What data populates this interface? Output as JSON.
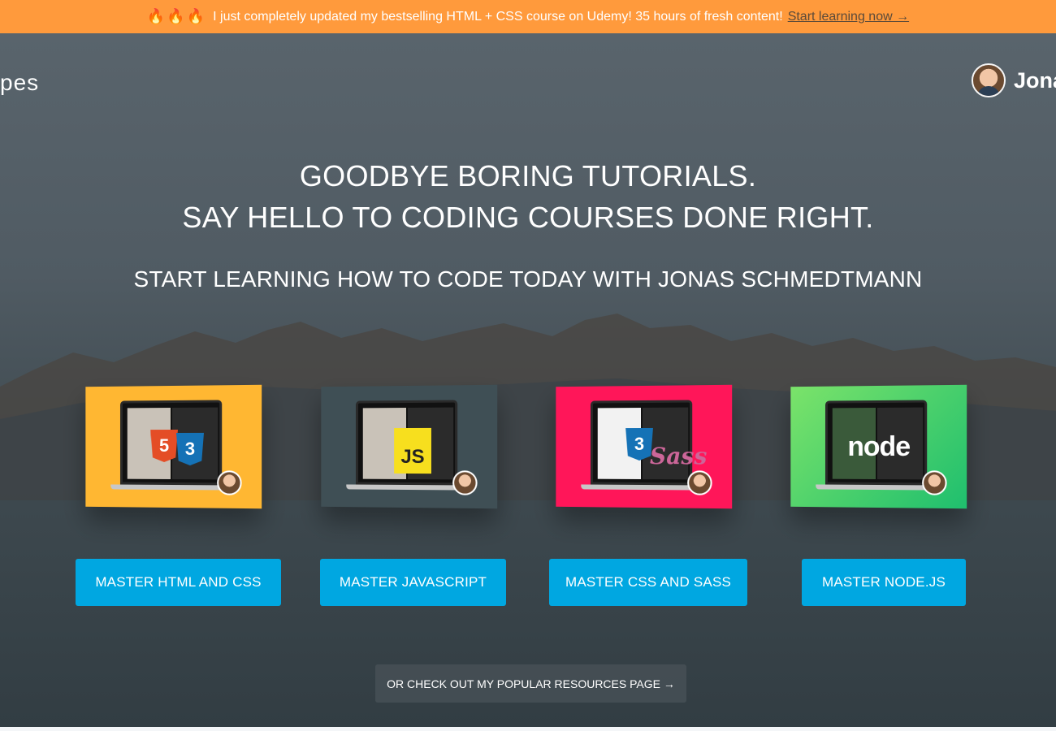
{
  "banner": {
    "emoji": "🔥🔥🔥",
    "text": "I just completely updated my bestselling HTML + CSS course on Udemy! 35 hours of fresh content!",
    "link": "Start learning now →"
  },
  "header": {
    "logo_fragment": "pes",
    "author_name": "Jona"
  },
  "hero": {
    "headline_line1": "GOODBYE BORING TUTORIALS.",
    "headline_line2": "SAY HELLO TO CODING COURSES DONE RIGHT.",
    "subheadline": "START LEARNING HOW TO CODE TODAY WITH JONAS SCHMEDTMANN"
  },
  "courses": [
    {
      "button": "MASTER HTML AND CSS",
      "color": "#ffb732",
      "badge1": "5",
      "badge2": "3"
    },
    {
      "button": "MASTER JAVASCRIPT",
      "color": "#3f4f55",
      "badge1": "JS"
    },
    {
      "button": "MASTER CSS AND SASS",
      "color": "#ff1659",
      "badge1": "3",
      "badge2": "Sass"
    },
    {
      "button": "MASTER NODE.JS",
      "color": "#4fd06a",
      "badge1": "node"
    }
  ],
  "resources_button": "OR CHECK OUT MY POPULAR RESOURCES PAGE →",
  "colors": {
    "banner": "#ff9a3c",
    "cta": "#00a7e1"
  }
}
